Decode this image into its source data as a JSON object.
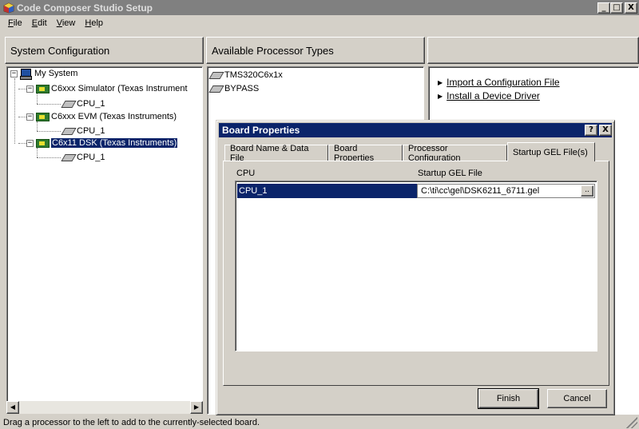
{
  "window": {
    "title": "Code Composer Studio Setup",
    "controls": {
      "minimize": "_",
      "maximize": "□",
      "close": "X"
    }
  },
  "menu": [
    {
      "label": "File",
      "accel": "F",
      "rest": "ile"
    },
    {
      "label": "Edit",
      "accel": "E",
      "rest": "dit"
    },
    {
      "label": "View",
      "accel": "V",
      "rest": "iew"
    },
    {
      "label": "Help",
      "accel": "H",
      "rest": "elp"
    }
  ],
  "panes": {
    "system_configuration": "System Configuration",
    "available_processor_types": "Available Processor Types"
  },
  "tree": {
    "root": "My System",
    "boards": [
      {
        "label": "C6xxx Simulator (Texas Instrument",
        "cpu": "CPU_1",
        "selected": false
      },
      {
        "label": "C6xxx EVM (Texas Instruments)",
        "cpu": "CPU_1",
        "selected": false
      },
      {
        "label": "C6x11 DSK (Texas Instruments)",
        "cpu": "CPU_1",
        "selected": true
      }
    ],
    "toggle_symbol": "−"
  },
  "available_processors": [
    "TMS320C6x1x",
    "BYPASS"
  ],
  "links": [
    "Import a Configuration File",
    "Install a Device Driver"
  ],
  "status": "Drag a processor to the left to add to the currently-selected board.",
  "dialog": {
    "title": "Board Properties",
    "help_button": "?",
    "close_button": "X",
    "tabs": [
      "Board Name & Data File",
      "Board Properties",
      "Processor Configuration",
      "Startup GEL File(s)"
    ],
    "active_tab": "Startup GEL File(s)",
    "columns": {
      "cpu": "CPU",
      "gel": "Startup GEL File"
    },
    "rows": [
      {
        "cpu": "CPU_1",
        "file": "C:\\ti\\cc\\gel\\DSK6211_6711.gel",
        "browse": ".."
      }
    ],
    "buttons": {
      "finish": "Finish",
      "cancel": "Cancel"
    }
  },
  "scrollbar": {
    "left": "◀",
    "right": "▶"
  },
  "colors": {
    "selection": "#0a246a",
    "face": "#d4d0c8",
    "inactive_title": "#808080"
  }
}
